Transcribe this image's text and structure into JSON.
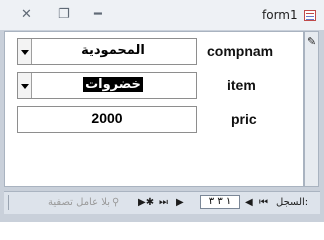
{
  "window": {
    "title": "form1",
    "close_glyph": "✕",
    "restore_glyph": "❐",
    "minimize_glyph": "━"
  },
  "form": {
    "record_selector_icon": "pencil-icon",
    "fields": {
      "compnam": {
        "label": "compnam",
        "value": "المحمودية"
      },
      "item": {
        "label": "item",
        "value": "خضروات"
      },
      "pric": {
        "label": "pric",
        "value": "2000"
      }
    }
  },
  "navbar": {
    "record_label": "السجل:",
    "first_glyph": "⏮",
    "prev_glyph": "◀",
    "position": "١ ٣ ٣",
    "next_glyph": "▶",
    "last_glyph": "⏭",
    "new_glyph": "▶✱",
    "filter_icon": "filter-icon",
    "filter_label": "بلا عامل تصفية"
  }
}
